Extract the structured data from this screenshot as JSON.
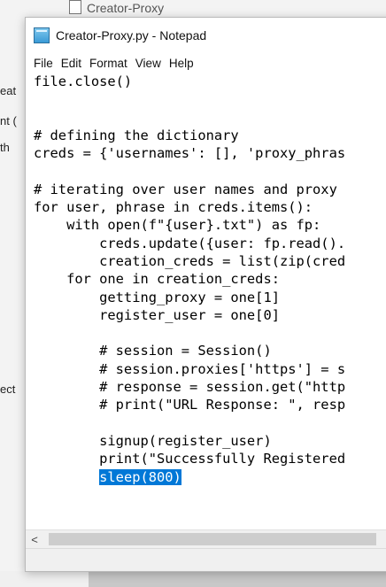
{
  "background": {
    "tab_title": "Creator-Proxy",
    "left_fragments": [
      "eat",
      "nt (",
      "th",
      "ect"
    ]
  },
  "window": {
    "title": "Creator-Proxy.py - Notepad"
  },
  "menu": {
    "items": [
      "File",
      "Edit",
      "Format",
      "View",
      "Help"
    ]
  },
  "editor": {
    "lines": [
      "file.close()",
      "",
      "",
      "# defining the dictionary",
      "creds = {'usernames': [], 'proxy_phras",
      "",
      "# iterating over user names and proxy",
      "for user, phrase in creds.items():",
      "    with open(f\"{user}.txt\") as fp:",
      "        creds.update({user: fp.read().",
      "        creation_creds = list(zip(cred",
      "    for one in creation_creds:",
      "        getting_proxy = one[1]",
      "        register_user = one[0]",
      "",
      "        # session = Session()",
      "        # session.proxies['https'] = s",
      "        # response = session.get(\"http",
      "        # print(\"URL Response: \", resp",
      "",
      "        signup(register_user)",
      "        print(\"Successfully Registered",
      "        "
    ],
    "selected_indent": "        ",
    "selected_text": "sleep(800)"
  },
  "scrollbar": {
    "left_arrow": "<"
  },
  "colors": {
    "selection": "#0078d7",
    "window_bg": "#ffffff",
    "chrome_bg": "#f0f0f0"
  }
}
